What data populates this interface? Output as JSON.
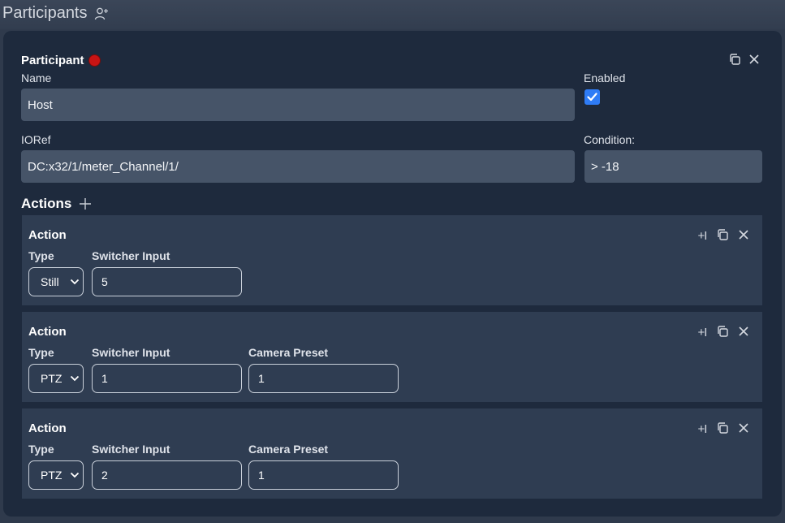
{
  "section": {
    "title": "Participants",
    "icon": "add-user-icon"
  },
  "participant": {
    "heading": "Participant",
    "name_label": "Name",
    "name_value": "Host",
    "enabled_label": "Enabled",
    "enabled": true,
    "ioref_label": "IORef",
    "ioref_value": "DC:x32/1/meter_Channel/1/",
    "condition_label": "Condition:",
    "condition_value": "> -18"
  },
  "actions": {
    "title": "Actions",
    "items": [
      {
        "title": "Action",
        "type_label": "Type",
        "type_value": "Still",
        "switcher_label": "Switcher Input",
        "switcher_value": "5"
      },
      {
        "title": "Action",
        "type_label": "Type",
        "type_value": "PTZ",
        "switcher_label": "Switcher Input",
        "switcher_value": "1",
        "preset_label": "Camera Preset",
        "preset_value": "1"
      },
      {
        "title": "Action",
        "type_label": "Type",
        "type_value": "PTZ",
        "switcher_label": "Switcher Input",
        "switcher_value": "2",
        "preset_label": "Camera Preset",
        "preset_value": "1"
      }
    ]
  },
  "controls": {
    "insert_label": "+I"
  },
  "colors": {
    "accent": "#2f7cf6",
    "status_red": "#c81414",
    "panel": "#1e2a3d",
    "card": "#2f3d52",
    "field": "#465468"
  }
}
